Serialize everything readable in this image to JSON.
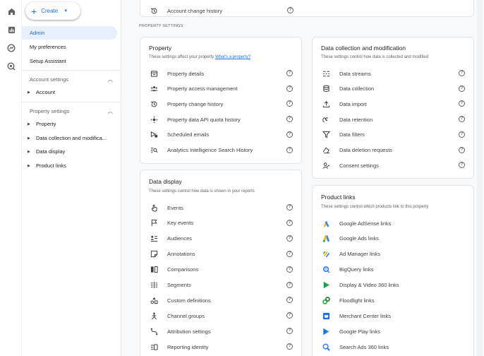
{
  "rail": {
    "icons": [
      "home-icon",
      "reports-icon",
      "explore-icon",
      "advertising-icon"
    ]
  },
  "nav": {
    "create_label": "Create",
    "items": [
      "Admin",
      "My preferences",
      "Setup Assistant"
    ],
    "account_settings": "Account settings",
    "account_sub": [
      "Account"
    ],
    "property_settings": "Property settings",
    "property_sub": [
      "Property",
      "Data collection and modifica...",
      "Data display",
      "Product links"
    ]
  },
  "top_row": {
    "label": "Account change history"
  },
  "section_label": "PROPERTY SETTINGS",
  "property_card": {
    "title": "Property",
    "subtitle": "These settings affect your property",
    "subtitle_link": "What's a property?",
    "rows": [
      {
        "label": "Property details",
        "icon": "property-details-icon"
      },
      {
        "label": "Property access management",
        "icon": "people-icon"
      },
      {
        "label": "Property change history",
        "icon": "history-icon"
      },
      {
        "label": "Property data API quota history",
        "icon": "quota-icon"
      },
      {
        "label": "Scheduled emails",
        "icon": "scheduled-email-icon"
      },
      {
        "label": "Analytics Intelligence Search History",
        "icon": "search-history-icon"
      }
    ]
  },
  "collection_card": {
    "title": "Data collection and modification",
    "subtitle": "These settings control how data is collected and modified",
    "rows": [
      {
        "label": "Data streams",
        "icon": "data-streams-icon"
      },
      {
        "label": "Data collection",
        "icon": "database-icon"
      },
      {
        "label": "Data import",
        "icon": "upload-icon"
      },
      {
        "label": "Data retention",
        "icon": "retention-icon"
      },
      {
        "label": "Data filters",
        "icon": "filter-icon"
      },
      {
        "label": "Data deletion requests",
        "icon": "eraser-icon"
      },
      {
        "label": "Consent settings",
        "icon": "consent-icon"
      }
    ]
  },
  "display_card": {
    "title": "Data display",
    "subtitle": "These settings control how data is shown in your reports",
    "rows": [
      {
        "label": "Events",
        "icon": "events-icon"
      },
      {
        "label": "Key events",
        "icon": "flag-icon"
      },
      {
        "label": "Audiences",
        "icon": "audiences-icon"
      },
      {
        "label": "Annotations",
        "icon": "annotation-icon"
      },
      {
        "label": "Comparisons",
        "icon": "comparisons-icon"
      },
      {
        "label": "Segments",
        "icon": "segments-icon"
      },
      {
        "label": "Custom definitions",
        "icon": "custom-definitions-icon"
      },
      {
        "label": "Channel groups",
        "icon": "channel-groups-icon"
      },
      {
        "label": "Attribution settings",
        "icon": "attribution-icon"
      },
      {
        "label": "Reporting identity",
        "icon": "reporting-identity-icon"
      }
    ]
  },
  "links_card": {
    "title": "Product links",
    "subtitle": "These settings control which products link to this property",
    "rows": [
      {
        "label": "Google AdSense links",
        "icon": "adsense-icon"
      },
      {
        "label": "Google Ads links",
        "icon": "google-ads-icon"
      },
      {
        "label": "Ad Manager links",
        "icon": "ad-manager-icon"
      },
      {
        "label": "BigQuery links",
        "icon": "bigquery-icon"
      },
      {
        "label": "Display & Video 360 links",
        "icon": "dv360-icon"
      },
      {
        "label": "Floodlight links",
        "icon": "floodlight-icon"
      },
      {
        "label": "Merchant Center links",
        "icon": "merchant-center-icon"
      },
      {
        "label": "Google Play links",
        "icon": "google-play-icon"
      },
      {
        "label": "Search Ads 360 links",
        "icon": "search-ads-360-icon"
      }
    ]
  },
  "colors": {
    "accent": "#1a73e8",
    "active_bg": "#e8f0fe",
    "page_bg": "#f8f9fa"
  }
}
